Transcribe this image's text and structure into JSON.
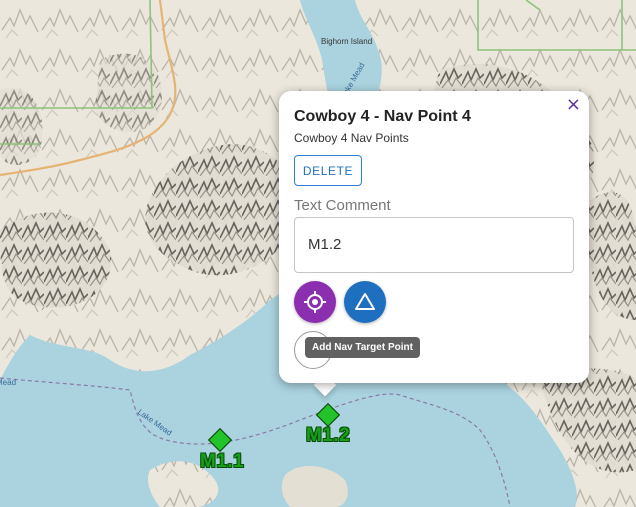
{
  "map": {
    "labels": {
      "island": "Bighorn Island",
      "lake_upper": "Lake Mead",
      "lake_lower": "Lake Mead",
      "lake_left": "Mead"
    },
    "colors": {
      "water": "#aad3df",
      "land": "#ece7dc",
      "boundary": "#8cc47a",
      "road": "#e5b474"
    }
  },
  "markers": [
    {
      "label": "M1.1",
      "color": "#22c42a"
    },
    {
      "label": "M1.2",
      "color": "#22c42a"
    }
  ],
  "popup": {
    "close_icon": "×",
    "title": "Cowboy 4 - Nav Point 4",
    "subtitle": "Cowboy 4 Nav Points",
    "delete_label": "DELETE",
    "comment_label": "Text Comment",
    "comment_value": "M1.2",
    "buttons": [
      {
        "icon": "crosshair-icon",
        "color": "#8b2fb0"
      },
      {
        "icon": "triangle-icon",
        "color": "#1e6fc0"
      },
      {
        "icon": "empty-circle-icon",
        "color": "#ffffff"
      }
    ],
    "tooltip": "Add Nav Target Point"
  }
}
